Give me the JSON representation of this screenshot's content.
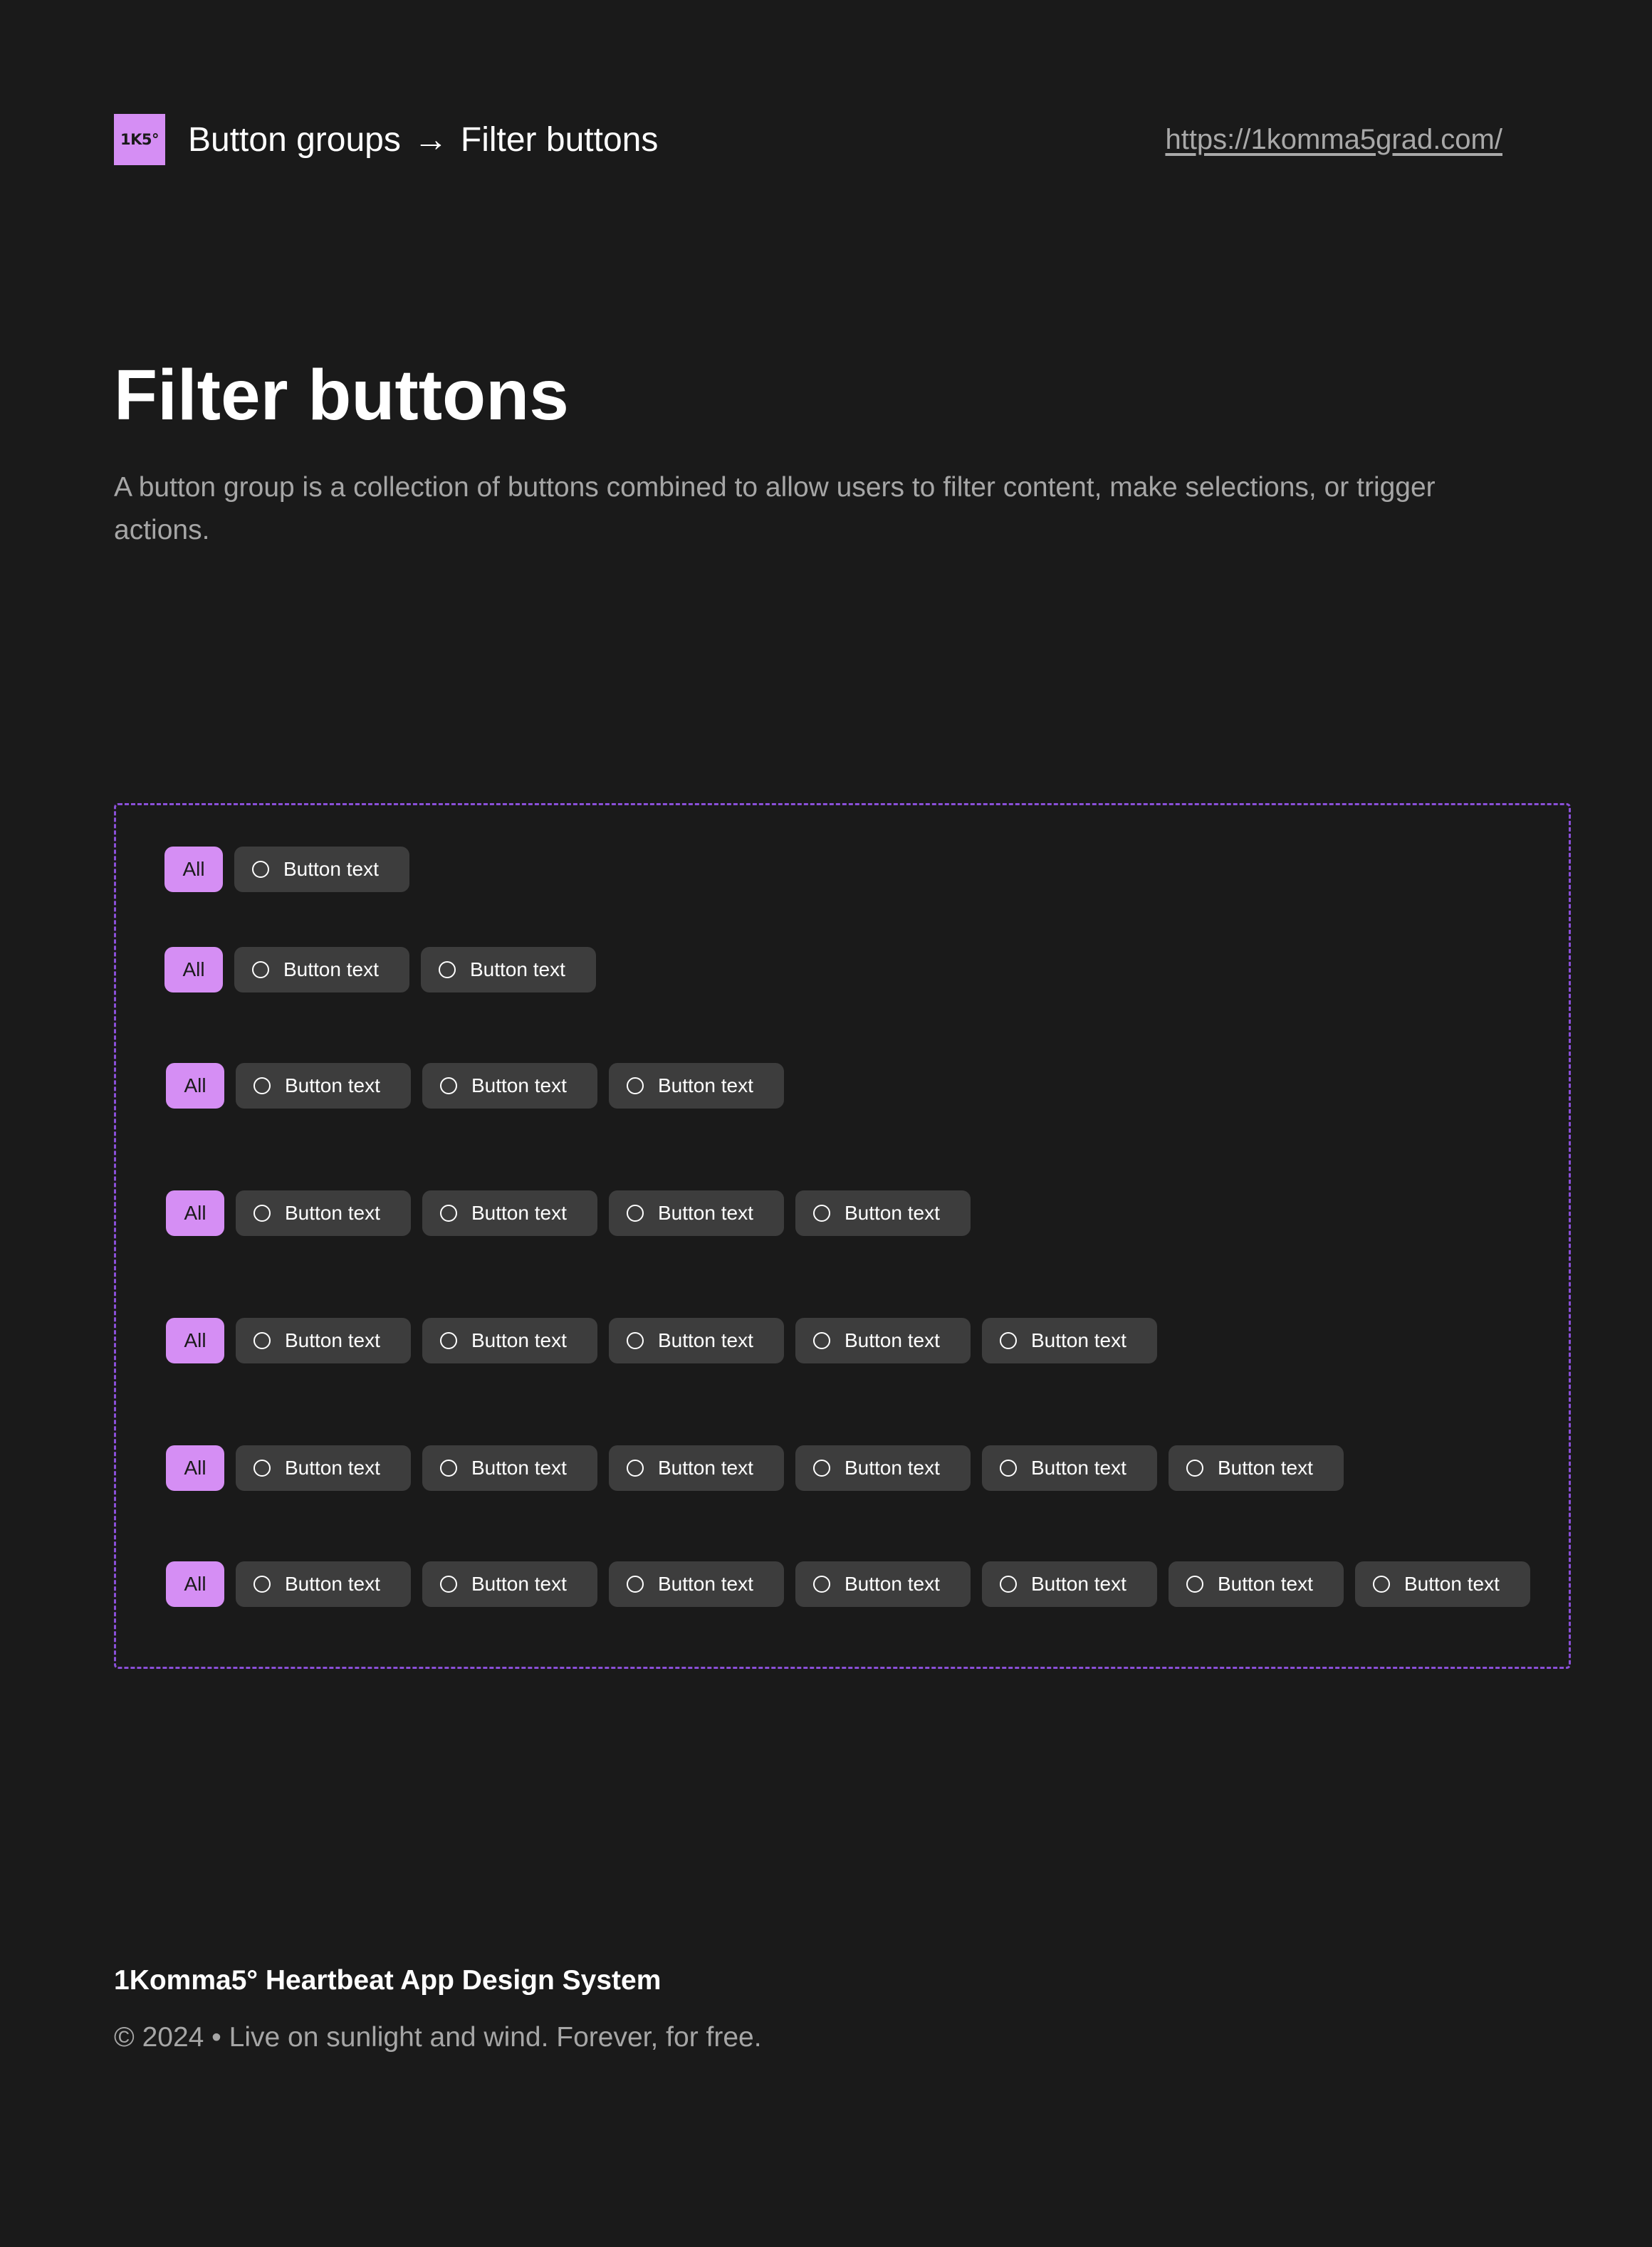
{
  "header": {
    "logo_text": "1K5°",
    "breadcrumb": {
      "parent": "Button groups",
      "separator": "→",
      "current": "Filter buttons"
    },
    "site_link": "https://1komma5grad.com/"
  },
  "page": {
    "title": "Filter buttons",
    "description": "A button group is a collection of buttons combined to allow users to filter content, make selections, or trigger actions."
  },
  "button_groups": [
    {
      "all_label": "All",
      "options": [
        "Button text"
      ]
    },
    {
      "all_label": "All",
      "options": [
        "Button text",
        "Button text"
      ]
    },
    {
      "all_label": "All",
      "options": [
        "Button text",
        "Button text",
        "Button text"
      ]
    },
    {
      "all_label": "All",
      "options": [
        "Button text",
        "Button text",
        "Button text",
        "Button text"
      ]
    },
    {
      "all_label": "All",
      "options": [
        "Button text",
        "Button text",
        "Button text",
        "Button text",
        "Button text"
      ]
    },
    {
      "all_label": "All",
      "options": [
        "Button text",
        "Button text",
        "Button text",
        "Button text",
        "Button text",
        "Button text"
      ]
    },
    {
      "all_label": "All",
      "options": [
        "Button text",
        "Button text",
        "Button text",
        "Button text",
        "Button text",
        "Button text",
        "Button text"
      ]
    }
  ],
  "footer": {
    "title": "1Komma5° Heartbeat App Design System",
    "copyright": "© 2024 • Live on sunlight and wind. Forever, for free."
  },
  "colors": {
    "background": "#1a1a1a",
    "accent": "#d58ef4",
    "option_button": "#3d3d3d",
    "frame_border": "#8a4fd8",
    "muted_text": "#a6a6a6"
  },
  "icons": {
    "option_icon": "radio-circle-icon"
  }
}
